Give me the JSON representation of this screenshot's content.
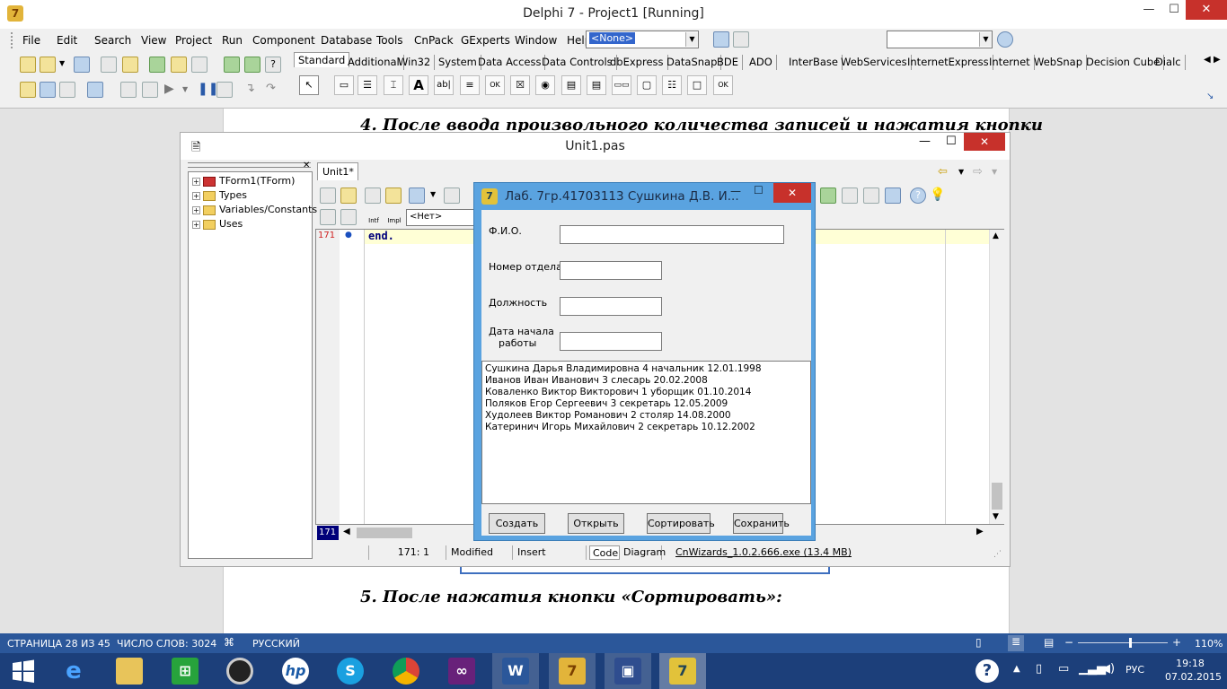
{
  "ide": {
    "title": "Delphi 7 - Project1 [Running]",
    "menu": [
      "File",
      "Edit",
      "Search",
      "View",
      "Project",
      "Run",
      "Component",
      "Database",
      "Tools",
      "CnPack",
      "GExperts",
      "Window",
      "Help"
    ],
    "config_select": "<None>",
    "palette_tabs": [
      "Standard",
      "Additional",
      "Win32",
      "System",
      "Data Access",
      "Data Controls",
      "dbExpress",
      "DataSnap",
      "BDE",
      "ADO",
      "InterBase",
      "WebServices",
      "InternetExpress",
      "Internet",
      "WebSnap",
      "Decision Cube",
      "Dialc"
    ],
    "active_tab": "Standard"
  },
  "doc": {
    "line4": "4.  После ввода произвольного количества записей и нажатия кнопки",
    "line5": "5.  После нажатия кнопки «Сортировать»:"
  },
  "unit_window": {
    "title": "Unit1.pas",
    "tab": "Unit1*",
    "tree": [
      "TForm1(TForm)",
      "Types",
      "Variables/Constants",
      "Uses"
    ],
    "code_line_number": "171",
    "code_text": "end.",
    "marker": "171",
    "status": {
      "position": "171:   1",
      "modified": "Modified",
      "mode": "Insert",
      "tabs": [
        "Code",
        "Diagram"
      ],
      "extra": "CnWizards_1.0.2.666.exe (13.4 MB)"
    },
    "intf_label": "Intf",
    "impl_label": "Impl",
    "nav_select": "<Нет>"
  },
  "lab_form": {
    "title": "Лаб. 7гр.41703113 Сушкина Д.В. И...",
    "labels": {
      "fio": "Ф.И.О.",
      "dept": "Номер отдела",
      "position": "Должность",
      "start_date_1": "Дата начала",
      "start_date_2": "работы"
    },
    "records": [
      "Сушкина Дарья Владимировна 4 начальник 12.01.1998",
      "Иванов Иван Иванович 3 слесарь 20.02.2008",
      "Коваленко Виктор Викторович 1 уборщик 01.10.2014",
      "Поляков Егор Сергеевич 3 секретарь 12.05.2009",
      "Худолеев Виктор Романович 2 столяр 14.08.2000",
      "Катеринич Игорь Михайлович 2 секретарь 10.12.2002"
    ],
    "buttons": {
      "create": "Создать",
      "open": "Открыть",
      "sort": "Сортировать",
      "save": "Сохранить"
    }
  },
  "word_status": {
    "page": "СТРАНИЦА 28 ИЗ 45",
    "words": "ЧИСЛО СЛОВ: 3024",
    "lang": "РУССКИЙ",
    "zoom": "110%",
    "zoom_level": 0.58
  },
  "taskbar": {
    "lang": "РУС",
    "time": "19:18",
    "date": "07.02.2015"
  }
}
